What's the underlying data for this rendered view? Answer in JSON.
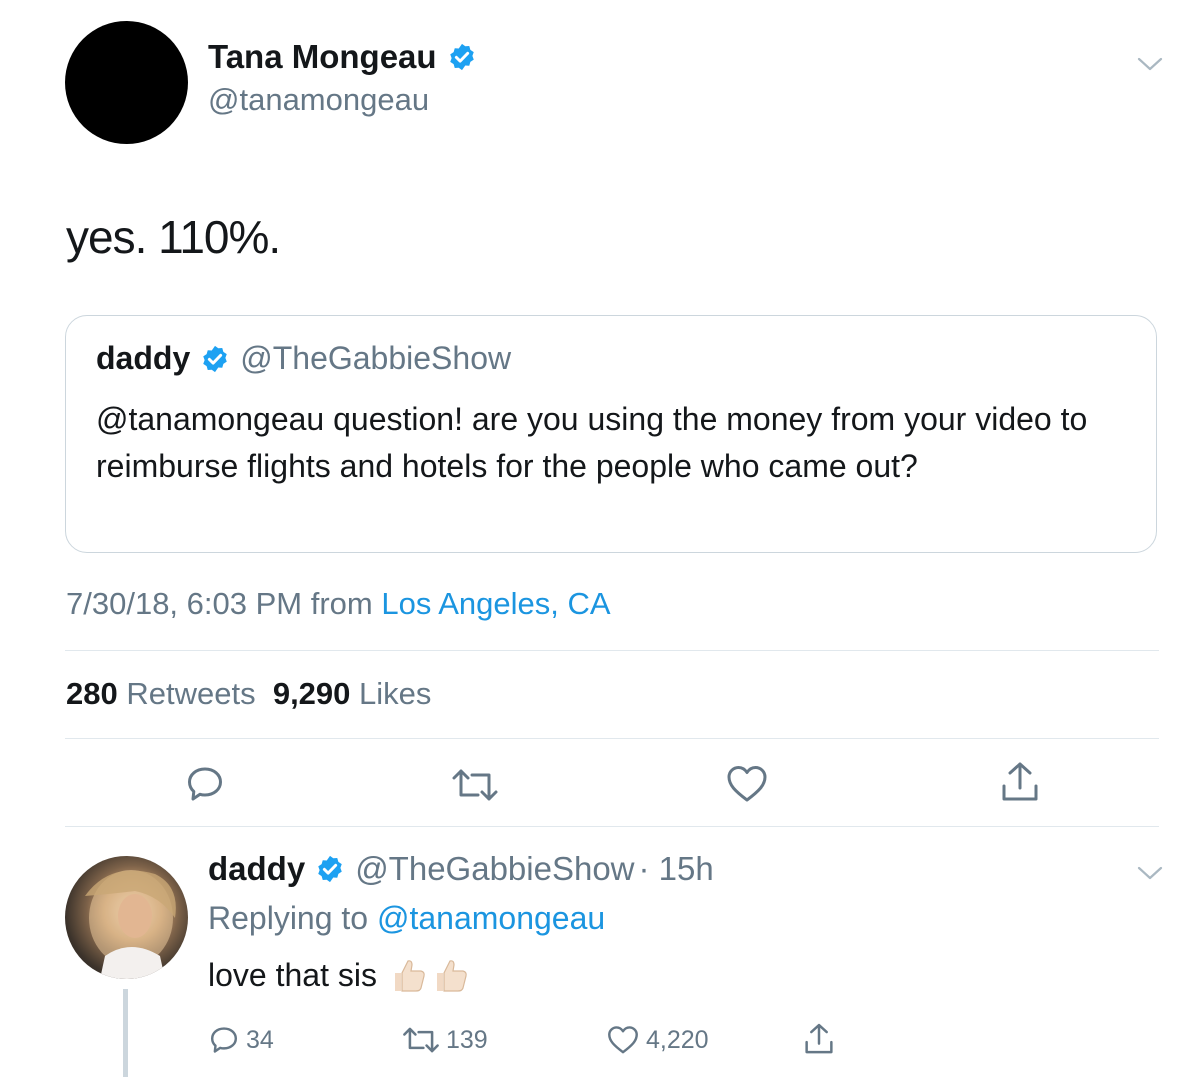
{
  "tweet": {
    "author_name": "Tana Mongeau",
    "author_handle": "@tanamongeau",
    "text": "yes. 110%.",
    "quote": {
      "name": "daddy",
      "handle": "@TheGabbieShow",
      "text": "@tanamongeau question! are you using the money from your video to reimburse flights and hotels for the people who came out?"
    },
    "timestamp": "7/30/18, 6:03 PM",
    "from_label": "from",
    "location": "Los Angeles, CA",
    "retweets_count": "280",
    "retweets_label": "Retweets",
    "likes_count": "9,290",
    "likes_label": "Likes"
  },
  "actions": [
    "reply-icon",
    "retweet-icon",
    "like-icon",
    "share-icon"
  ],
  "reply": {
    "name": "daddy",
    "handle": "@TheGabbieShow",
    "time": "· 15h",
    "replying_label": "Replying to",
    "replying_handle": "@tanamongeau",
    "text": "love that sis",
    "reply_count": "34",
    "retweet_count": "139",
    "like_count": "4,220"
  },
  "colors": {
    "link": "#1b95e0",
    "muted": "#657786",
    "verified": "#1da1f2",
    "border": "#e1e8ed"
  }
}
